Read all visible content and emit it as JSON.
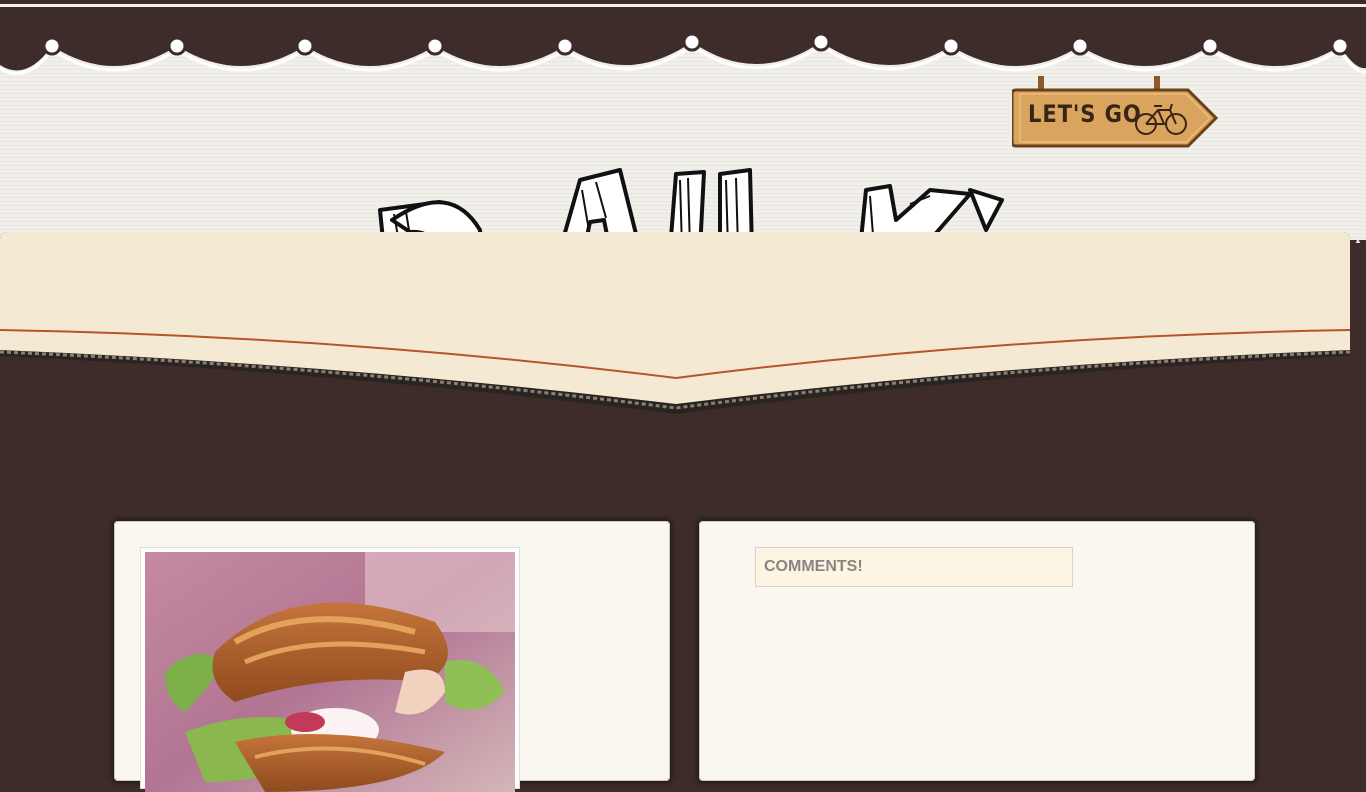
{
  "header": {
    "sign_label": "LET'S GO",
    "sign_icon": "bicycle-icon"
  },
  "sidebar": {
    "comments_title": "COMMENTS!"
  },
  "colors": {
    "page_background": "#3d2c2a",
    "header_background": "#f1efea",
    "banner_cream": "#f4ead4",
    "banner_stripe": "#b8542a",
    "card_background": "#f9f7ef",
    "comments_background": "#fcf5e3"
  }
}
